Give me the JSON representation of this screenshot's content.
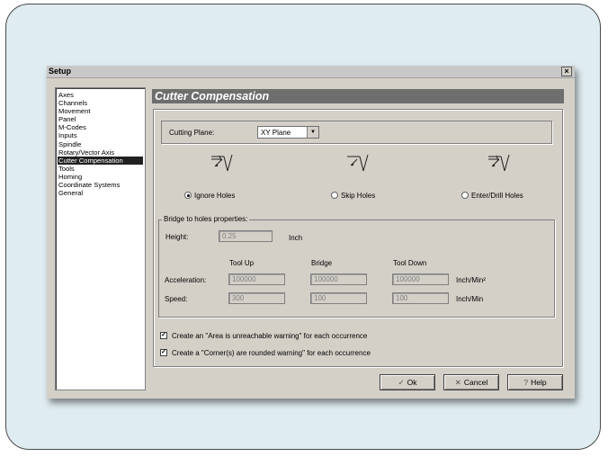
{
  "window": {
    "title": "Setup",
    "close_glyph": "×"
  },
  "nav": {
    "items": [
      {
        "label": "Axes",
        "selected": false
      },
      {
        "label": "Channels",
        "selected": false
      },
      {
        "label": "Movement",
        "selected": false
      },
      {
        "label": "Panel",
        "selected": false
      },
      {
        "label": "M-Codes",
        "selected": false
      },
      {
        "label": "Inputs",
        "selected": false
      },
      {
        "label": "Spindle",
        "selected": false
      },
      {
        "label": "Rotary/Vector Axis",
        "selected": false
      },
      {
        "label": "Cutter Compensation",
        "selected": true
      },
      {
        "label": "Tools",
        "selected": false
      },
      {
        "label": "Homing",
        "selected": false
      },
      {
        "label": "Coordinate Systems",
        "selected": false
      },
      {
        "label": "General",
        "selected": false
      }
    ]
  },
  "section": {
    "title": "Cutter Compensation"
  },
  "cutting_plane": {
    "label": "Cutting Plane:",
    "value": "XY Plane"
  },
  "hole_modes": [
    {
      "label": "Ignore Holes",
      "selected": true,
      "icon": "ignore-holes-icon"
    },
    {
      "label": "Skip Holes",
      "selected": false,
      "icon": "skip-holes-icon"
    },
    {
      "label": "Enter/Drill Holes",
      "selected": false,
      "icon": "enter-drill-holes-icon"
    }
  ],
  "bridge": {
    "legend": "Bridge to holes properties:",
    "height_label": "Height:",
    "height_value": "0.25",
    "height_unit": "Inch",
    "columns": [
      "Tool Up",
      "Bridge",
      "Tool Down"
    ],
    "acceleration": {
      "label": "Acceleration:",
      "values": [
        "100000",
        "100000",
        "100000"
      ],
      "unit": "Inch/Min²"
    },
    "speed": {
      "label": "Speed:",
      "values": [
        "300",
        "100",
        "100"
      ],
      "unit": "Inch/Min"
    }
  },
  "warnings": [
    {
      "label": "Create an \"Area is unreachable warning\" for each occurrence",
      "checked": true
    },
    {
      "label": "Create a \"Corner(s) are rounded warning\" for each occurrence",
      "checked": true
    }
  ],
  "buttons": {
    "ok": "Ok",
    "cancel": "Cancel",
    "help": "Help"
  }
}
